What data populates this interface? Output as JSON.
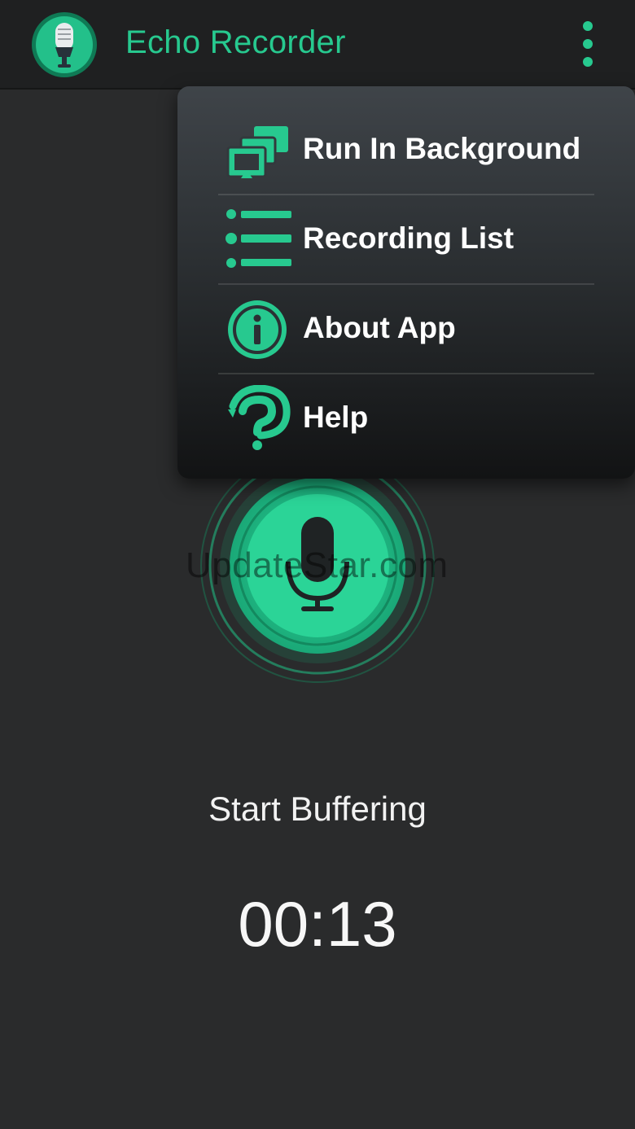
{
  "app": {
    "title": "Echo Recorder",
    "accent_color": "#27c98f",
    "logo_icon": "microphone-logo-icon"
  },
  "menu": {
    "items": [
      {
        "label": "Run In Background",
        "icon": "monitors-icon"
      },
      {
        "label": "Recording List",
        "icon": "list-icon"
      },
      {
        "label": "About App",
        "icon": "info-icon"
      },
      {
        "label": "Help",
        "icon": "help-icon"
      }
    ]
  },
  "recorder": {
    "status": "Start Buffering",
    "elapsed": "00:13",
    "mic_icon": "microphone-icon"
  },
  "watermark": "UpdateStar.com"
}
